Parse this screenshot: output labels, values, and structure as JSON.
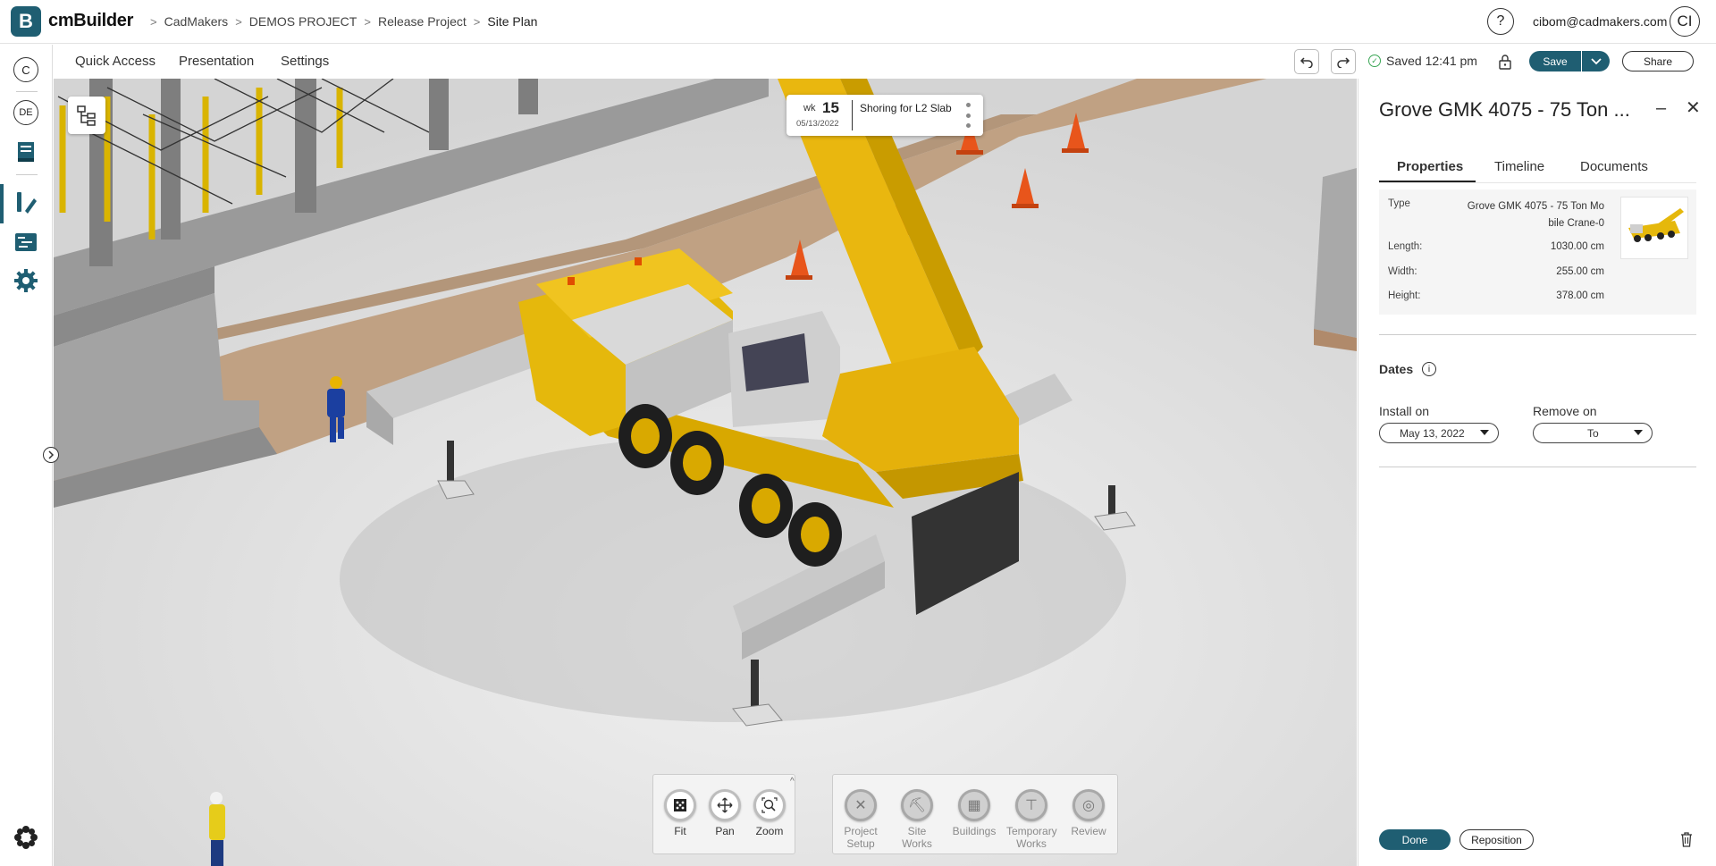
{
  "app": {
    "logo_letter": "B",
    "name": "cmBuilder",
    "brand_color": "#1f5e72"
  },
  "breadcrumb": [
    "CadMakers",
    "DEMOS PROJECT",
    "Release Project",
    "Site Plan"
  ],
  "header": {
    "help_symbol": "?",
    "user_email": "cibom@cadmakers.com",
    "avatar_initials": "CI"
  },
  "leftrail": {
    "company_initial": "C",
    "language": "DE",
    "icons": [
      "model-book-icon",
      "design-pen-icon",
      "schedule-board-icon",
      "gear-icon",
      "apps-flower-icon"
    ]
  },
  "toolbar": {
    "menus": [
      "Quick Access",
      "Presentation",
      "Settings"
    ],
    "saved_text": "Saved 12:41 pm",
    "save_label": "Save",
    "share_label": "Share"
  },
  "schedule_card": {
    "wk_label": "wk",
    "wk_number": "15",
    "date": "05/13/2022",
    "task": "Shoring for L2 Slab"
  },
  "view_tools": [
    {
      "label": "Fit",
      "icon": "fit-icon"
    },
    {
      "label": "Pan",
      "icon": "pan-icon"
    },
    {
      "label": "Zoom",
      "icon": "zoom-icon"
    }
  ],
  "category_tools": [
    {
      "label1": "Project",
      "label2": "Setup",
      "icon": "tools-icon"
    },
    {
      "label1": "Site Works",
      "label2": "",
      "icon": "excavator-icon"
    },
    {
      "label1": "Buildings",
      "label2": "",
      "icon": "building-icon"
    },
    {
      "label1": "Temporary",
      "label2": "Works",
      "icon": "crane-icon"
    },
    {
      "label1": "Review",
      "label2": "",
      "icon": "review-icon"
    }
  ],
  "panel": {
    "title": "Grove GMK 4075 - 75 Ton ...",
    "tabs": [
      "Properties",
      "Timeline",
      "Documents"
    ],
    "active_tab": "Properties",
    "properties": {
      "type_label": "Type",
      "type_value": "Grove GMK 4075 - 75 Ton Mobile Crane-0",
      "length_label": "Length:",
      "length_value": "1030.00 cm",
      "width_label": "Width:",
      "width_value": "255.00 cm",
      "height_label": "Height:",
      "height_value": "378.00 cm"
    },
    "dates_label": "Dates",
    "install_label": "Install on",
    "install_value": "May 13, 2022",
    "remove_label": "Remove on",
    "remove_value": "To",
    "done_label": "Done",
    "reposition_label": "Reposition"
  }
}
